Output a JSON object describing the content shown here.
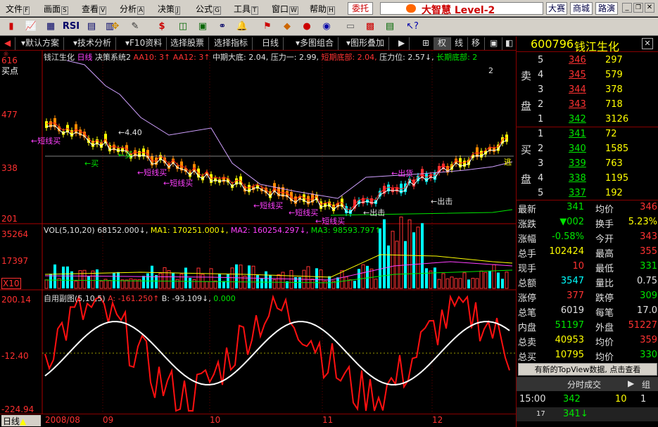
{
  "menu": {
    "items": [
      "文件",
      "画面",
      "查看",
      "分析",
      "决策",
      "公式",
      "工具",
      "窗口",
      "帮助"
    ],
    "entrust": "委托",
    "brand": "大智慧 Level-2",
    "contest": "大赛",
    "mall": "商城",
    "speech": "路演"
  },
  "toolbar": {
    "rsi_label": "RSI",
    "icons": [
      "candlestick-icon",
      "line-chart-icon",
      "grid-icon",
      "rsi-icon",
      "table-icon",
      "bar-icon",
      "move-icon",
      "pen-icon",
      "dollar-icon",
      "map-icon",
      "binoculars-icon",
      "alert-icon",
      "flag-icon",
      "diamond-icon",
      "ball-icon",
      "globe-icon",
      "note-icon",
      "book-icon",
      "news-icon",
      "help-icon"
    ]
  },
  "tabs": [
    "默认方案",
    "技术分析",
    "F10资料",
    "选择股票",
    "选择指标",
    "日线",
    "多图组合",
    "图形叠加",
    "权",
    "线",
    "移"
  ],
  "chart": {
    "title_bar": {
      "name": "钱江生化",
      "period": "日线",
      "system": "决策系统2",
      "aa10": "AA10: 3↑",
      "aa12": "AA12: 3↑",
      "zhong": "中期大底: 2.04,",
      "yali": "压力一: 2.99,",
      "duanqi": "短期底部: 2.04,",
      "yali_wei": "压力位: 2.57↓,",
      "changqi": "长期底部: 2",
      "buy_point": "买点"
    },
    "price_axis": [
      "616",
      "477",
      "338",
      "201"
    ],
    "marks": {
      "p440": "4.40",
      "buy1": "买",
      "buy2": "买",
      "short1": "短线买",
      "short2": "短线买",
      "short3": "短线买",
      "short4": "短线买",
      "short5": "短线买",
      "short6": "短线买",
      "out1": "出货",
      "out2": "出击",
      "out3": "出击",
      "escape": "逃",
      "two": "2"
    },
    "vol_bar": {
      "label": "VOL(5,10,20)",
      "v": "68152.000↓,",
      "ma1": "MA1: 170251.000↓,",
      "ma2": "MA2: 160254.297↓,",
      "ma3": "MA3: 98593.797↑"
    },
    "vol_axis": [
      "35264",
      "17397",
      "X10"
    ],
    "osc_bar": {
      "label": "自用副图(5,10,5)",
      "a": "A: -161.250↑",
      "b": "B: -93.109↓,",
      "z": "0.000"
    },
    "osc_axis": [
      "200.14",
      "-12.40",
      "-224.94"
    ],
    "date_axis": [
      "2008/08",
      "09",
      "10",
      "11",
      "12"
    ],
    "period_tab": "日线"
  },
  "quote": {
    "code": "600796",
    "name": "钱江生化",
    "sell_label": [
      "卖",
      "盘"
    ],
    "buy_label": [
      "买",
      "盘"
    ],
    "sell": [
      [
        "5",
        "346",
        "297"
      ],
      [
        "4",
        "345",
        "579"
      ],
      [
        "3",
        "344",
        "378"
      ],
      [
        "2",
        "343",
        "718"
      ],
      [
        "1",
        "342",
        "3126"
      ]
    ],
    "buy": [
      [
        "1",
        "341",
        "72"
      ],
      [
        "2",
        "340",
        "1585"
      ],
      [
        "3",
        "339",
        "763"
      ],
      [
        "4",
        "338",
        "1195"
      ],
      [
        "5",
        "337",
        "192"
      ]
    ],
    "stats": [
      [
        "最新",
        "341",
        "均价",
        "346"
      ],
      [
        "涨跌",
        "▼002",
        "换手",
        "5.23%"
      ],
      [
        "涨幅",
        "-0.58%",
        "今开",
        "343"
      ],
      [
        "总手",
        "102424",
        "最高",
        "355"
      ],
      [
        "现手",
        "10",
        "最低",
        "331"
      ],
      [
        "总额",
        "3547",
        "量比",
        "0.75"
      ],
      [
        "涨停",
        "377",
        "跌停",
        "309"
      ],
      [
        "总笔",
        "6019",
        "每笔",
        "17.0"
      ],
      [
        "内盘",
        "51197",
        "外盘",
        "51227"
      ],
      [
        "总卖",
        "40953",
        "均价",
        "359"
      ],
      [
        "总买",
        "10795",
        "均价",
        "330"
      ]
    ],
    "topview": "有新的TopView数据, 点击查看",
    "trades_title": "分时成交",
    "trade_tab": "组",
    "trade_row": [
      "15:00",
      "342",
      "10",
      "1"
    ],
    "trade_row2": [
      "17",
      "341↓"
    ]
  }
}
